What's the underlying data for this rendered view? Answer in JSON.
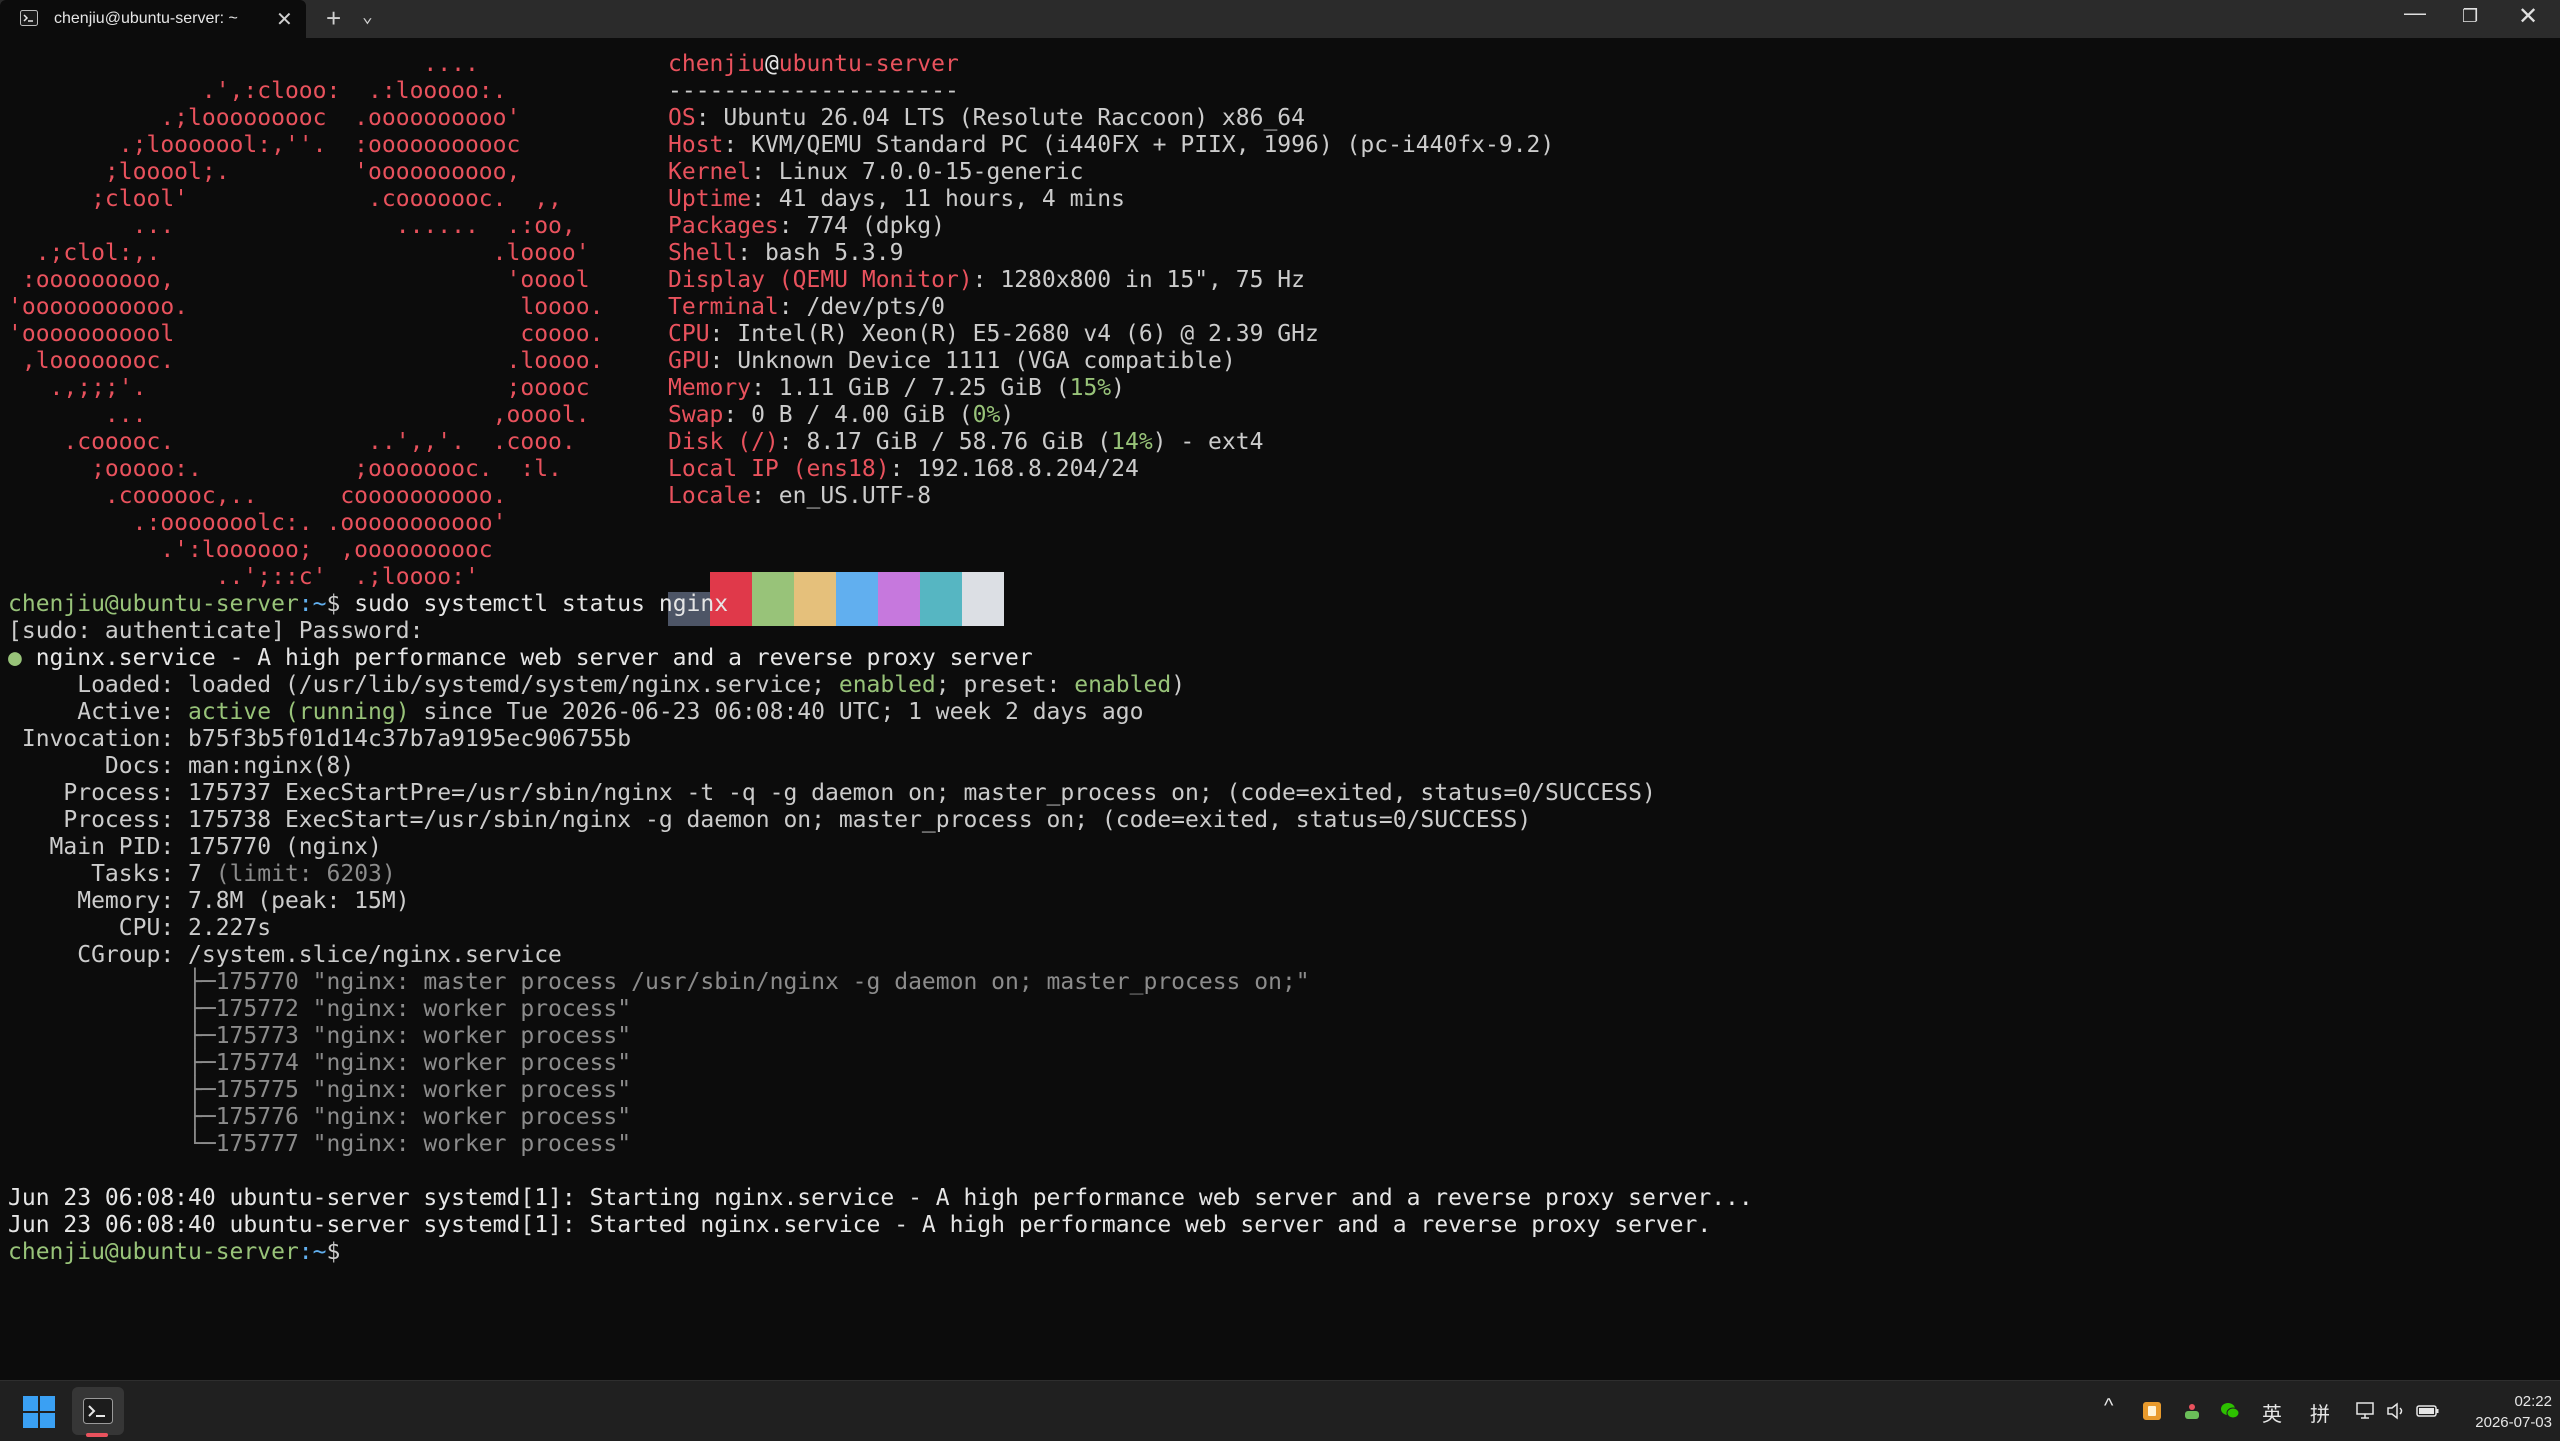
{
  "window": {
    "tab_title": "chenjiu@ubuntu-server: ~",
    "tab_close": "✕",
    "new_tab": "+",
    "dropdown": "⌄",
    "minimize": "—",
    "restore": "❐",
    "close": "✕"
  },
  "logo_lines": [
    "                              ....",
    "              .',:clooo:  .:looooo:.",
    "           .;looooooooc  .oooooooooo'",
    "        .;looooool:,''.  :ooooooooooc",
    "       ;looool;.         'oooooooooo,",
    "      ;clool'             .cooooooc.  ,,",
    "         ...                ......  .:oo,",
    "  .;clol:,.                        .loooo'",
    " :ooooooooo,                        'ooool",
    "'ooooooooooo.                        loooo.",
    "'ooooooooool                         coooo.",
    " ,loooooooc.                        .loooo.",
    "   .,;;;'.                          ;ooooc",
    "       ...                         ,ooool.",
    "    .cooooc.              ..',,'.  .cooo.",
    "      ;ooooo:.           ;oooooooc.  :l.",
    "       .coooooc,..      coooooooooo.",
    "         .:ooooooolc:. .ooooooooooo'",
    "           .':loooooo;  ,oooooooooc",
    "               ..';::c'  .;loooo:'"
  ],
  "sysinfo": {
    "user": "chenjiu",
    "at": "@",
    "host": "ubuntu-server",
    "separator": "---------------------",
    "rows": [
      {
        "key": "OS",
        "value": "Ubuntu 26.04 LTS (Resolute Raccoon) x86_64"
      },
      {
        "key": "Host",
        "value": "KVM/QEMU Standard PC (i440FX + PIIX, 1996) (pc-i440fx-9.2)"
      },
      {
        "key": "Kernel",
        "value": "Linux 7.0.0-15-generic"
      },
      {
        "key": "Uptime",
        "value": "41 days, 11 hours, 4 mins"
      },
      {
        "key": "Packages",
        "value": "774 (dpkg)"
      },
      {
        "key": "Shell",
        "value": "bash 5.3.9"
      },
      {
        "key": "Display (QEMU Monitor)",
        "value": "1280x800 in 15\", 75 Hz"
      },
      {
        "key": "Terminal",
        "value": "/dev/pts/0"
      },
      {
        "key": "CPU",
        "value": "Intel(R) Xeon(R) E5-2680 v4 (6) @ 2.39 GHz"
      },
      {
        "key": "GPU",
        "value": "Unknown Device 1111 (VGA compatible)"
      },
      {
        "key": "Memory",
        "value": "1.11 GiB / 7.25 GiB (",
        "pct": "15%",
        "tail": ")"
      },
      {
        "key": "Swap",
        "value": "0 B / 4.00 GiB (",
        "pct": "0%",
        "tail": ")"
      },
      {
        "key": "Disk (/)",
        "value": "8.17 GiB / 58.76 GiB (",
        "pct": "14%",
        "tail": ") - ext4"
      },
      {
        "key": "Local IP (ens18)",
        "value": "192.168.8.204/24"
      },
      {
        "key": "Locale",
        "value": "en_US.UTF-8"
      }
    ],
    "palette": [
      "#4d5566",
      "#e0394a",
      "#98c379",
      "#e5c07b",
      "#61afef",
      "#c678dd",
      "#56b6c2",
      "#dcdfe4"
    ]
  },
  "prompt": {
    "user_host": "chenjiu@ubuntu-server",
    "path": ":~",
    "symbol": "$",
    "command": " sudo systemctl status nginx"
  },
  "status": {
    "sudo_prompt": "[sudo: authenticate] Password:",
    "bullet": "●",
    "service_line": " nginx.service - A high performance web server and a reverse proxy server",
    "loaded_label": "     Loaded: ",
    "loaded_value": "loaded (/usr/lib/systemd/system/nginx.service; ",
    "loaded_enabled": "enabled",
    "loaded_preset": "; preset: ",
    "loaded_preset_value": "enabled",
    "loaded_close": ")",
    "active_label": "     Active: ",
    "active_value": "active (running)",
    "active_since": " since Tue 2026-06-23 06:08:40 UTC; 1 week 2 days ago",
    "invocation": " Invocation: b75f3b5f01d14c37b7a9195ec906755b",
    "docs": "       Docs: man:nginx(8)",
    "process1": "    Process: 175737 ExecStartPre=/usr/sbin/nginx -t -q -g daemon on; master_process on; (code=exited, status=0/SUCCESS)",
    "process2": "    Process: 175738 ExecStart=/usr/sbin/nginx -g daemon on; master_process on; (code=exited, status=0/SUCCESS)",
    "main_pid": "   Main PID: 175770 (nginx)",
    "tasks_label": "      Tasks: 7",
    "tasks_limit": " (limit: 6203)",
    "memory": "     Memory: 7.8M (peak: 15M)",
    "cpu": "        CPU: 2.227s",
    "cgroup": "     CGroup: /system.slice/nginx.service",
    "tree": [
      "             ├─175770 \"nginx: master process /usr/sbin/nginx -g daemon on; master_process on;\"",
      "             ├─175772 \"nginx: worker process\"",
      "             ├─175773 \"nginx: worker process\"",
      "             ├─175774 \"nginx: worker process\"",
      "             ├─175775 \"nginx: worker process\"",
      "             ├─175776 \"nginx: worker process\"",
      "             └─175777 \"nginx: worker process\""
    ],
    "log1": "Jun 23 06:08:40 ubuntu-server systemd[1]: Starting nginx.service - A high performance web server and a reverse proxy server...",
    "log2": "Jun 23 06:08:40 ubuntu-server systemd[1]: Started nginx.service - A high performance web server and a reverse proxy server."
  },
  "taskbar": {
    "tray_chevron": "^",
    "ime_lang": "英",
    "ime_mode": "拼",
    "time": "02:22",
    "date": "2026-07-03"
  }
}
